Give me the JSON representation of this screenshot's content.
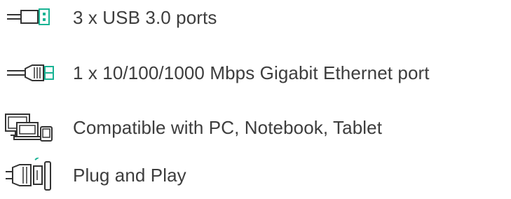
{
  "features": [
    {
      "icon": "usb-plug-icon",
      "label": "3 x USB 3.0 ports"
    },
    {
      "icon": "ethernet-plug-icon",
      "label": "1 x 10/100/1000 Mbps Gigabit Ethernet port"
    },
    {
      "icon": "devices-icon",
      "label": "Compatible with PC, Notebook, Tablet"
    },
    {
      "icon": "plug-and-play-icon",
      "label": "Plug and Play"
    }
  ],
  "colors": {
    "text": "#3d3d3d",
    "icon_stroke": "#333333",
    "accent": "#19b394"
  }
}
